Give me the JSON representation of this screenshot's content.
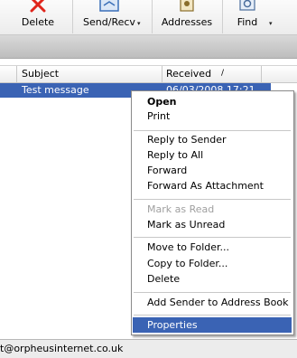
{
  "toolbar": {
    "delete_label": "Delete",
    "sendrecv_label": "Send/Recv",
    "addresses_label": "Addresses",
    "find_label": "Find",
    "dropdown_arrow": "▾"
  },
  "list": {
    "columns": {
      "subject": "Subject",
      "received": "Received",
      "sort_indicator": "/"
    },
    "selected_row": {
      "subject": "Test message",
      "received": "06/03/2008 17:21"
    }
  },
  "status": {
    "text": "t@orpheusinternet.co.uk"
  },
  "context_menu": {
    "items": [
      {
        "label": "Open",
        "bold": true
      },
      {
        "label": "Print"
      },
      {
        "label": "Reply to Sender"
      },
      {
        "label": "Reply to All"
      },
      {
        "label": "Forward"
      },
      {
        "label": "Forward As Attachment"
      },
      {
        "label": "Mark as Read",
        "disabled": true
      },
      {
        "label": "Mark as Unread"
      },
      {
        "label": "Move to Folder..."
      },
      {
        "label": "Copy to Folder..."
      },
      {
        "label": "Delete"
      },
      {
        "label": "Add Sender to Address Book"
      },
      {
        "label": "Properties",
        "highlighted": true
      }
    ]
  },
  "colors": {
    "selection": "#3a63b4",
    "delete_icon": "#e0251b"
  },
  "icons": [
    "delete-x-icon",
    "send-receive-icon",
    "addresses-icon",
    "find-icon"
  ]
}
